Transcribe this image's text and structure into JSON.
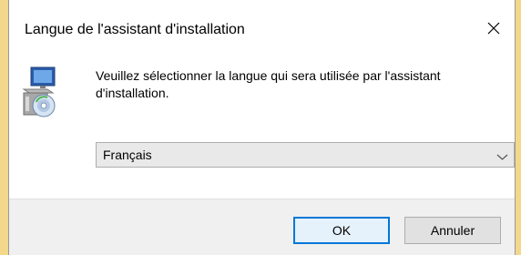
{
  "dialog": {
    "title": "Langue de l'assistant d'installation",
    "close_icon": "close-icon",
    "app_icon": "installer-package-icon",
    "message": "Veuillez sélectionner la langue qui sera utilisée par l'assistant d'installation.",
    "language_select": {
      "selected": "Français",
      "chevron_icon": "chevron-down-icon"
    },
    "buttons": {
      "ok_label": "OK",
      "cancel_label": "Annuler"
    }
  },
  "colors": {
    "desktop_background": "#f3d78a",
    "accent": "#0078d7",
    "footer": "#f0f0f0"
  }
}
